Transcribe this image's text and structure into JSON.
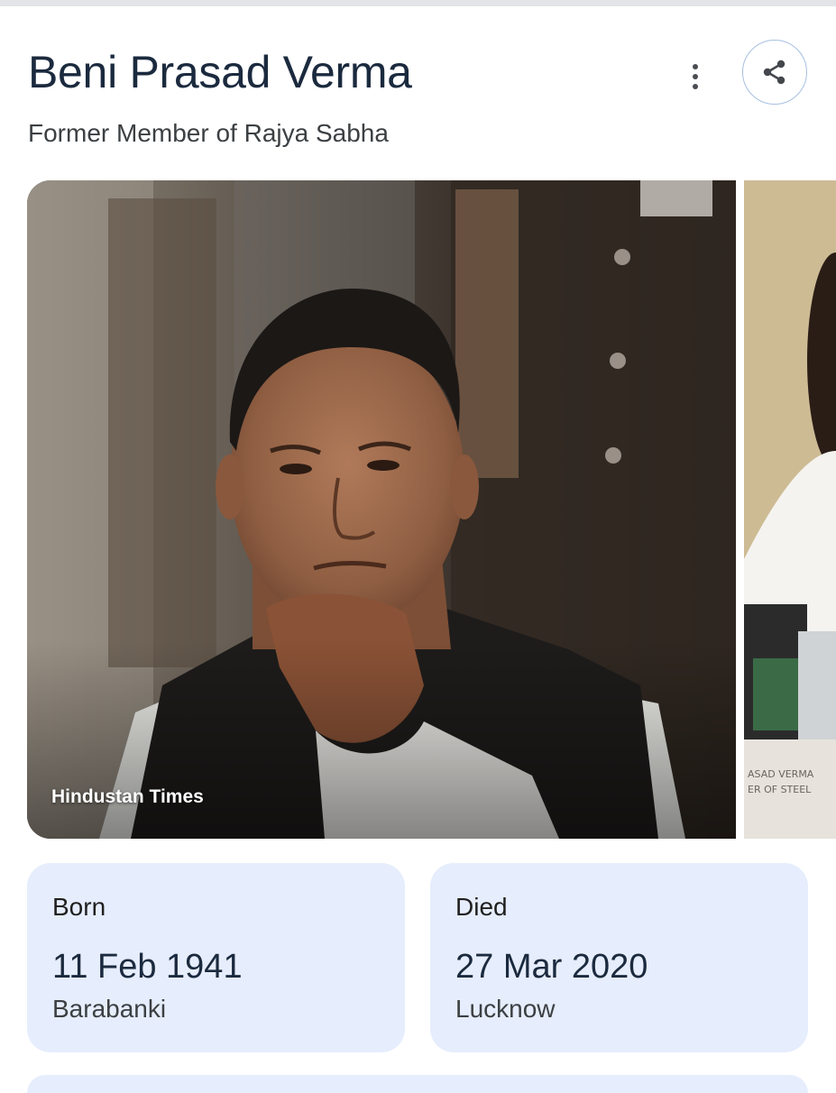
{
  "entity": {
    "name": "Beni Prasad Verma",
    "description": "Former Member of Rajya Sabha"
  },
  "actions": {
    "more_icon": "more-vert-icon",
    "share_icon": "share-icon"
  },
  "images": {
    "main_credit": "Hindustan Times",
    "second_caption_line1": "ASAD VERMA",
    "second_caption_line2": "ER OF STEEL"
  },
  "facts": {
    "born": {
      "label": "Born",
      "date": "11 Feb 1941",
      "place": "Barabanki"
    },
    "died": {
      "label": "Died",
      "date": "27 Mar 2020",
      "place": "Lucknow"
    }
  },
  "colors": {
    "card_background": "#e6edfc",
    "title_text": "#1b2a3e",
    "share_border": "#a7bfe0"
  }
}
